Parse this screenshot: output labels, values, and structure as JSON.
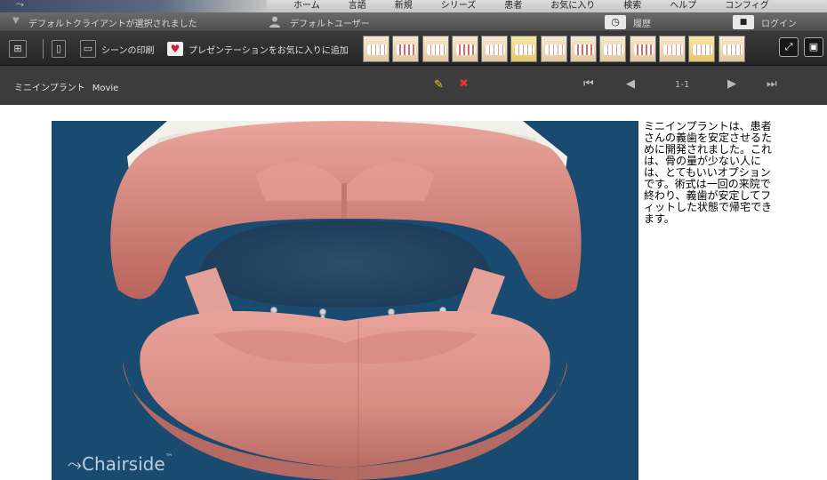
{
  "nav": {
    "items": [
      "ホーム",
      "言語",
      "新規",
      "シリーズ",
      "患者",
      "お気に入り",
      "検索",
      "ヘルプ",
      "コンフィグ"
    ]
  },
  "status": {
    "client": "デフォルトクライアントが選択されました",
    "user": "デフォルトユーザー",
    "history": "履歴",
    "login": "ログイン"
  },
  "toolbar": {
    "print_label": "シーンの印刷",
    "favorite_label": "プレゼンテーションをお気に入りに追加",
    "thumbnail_count": 13
  },
  "titlebar": {
    "title": "ミニインプラント",
    "type": "Movie",
    "page": "1-1"
  },
  "video": {
    "watermark": "Chairside",
    "trademark": "™"
  },
  "description": "ミニインプラントは、患者さんの義歯を安定させるために開発されました。これは、骨の量が少ない人には、とてもいいオプションです。術式は一回の来院で終わり、義歯が安定してフィットした状態で帰宅できます。",
  "colors": {
    "video_bg": "#194a6f",
    "gum": "#d98a83",
    "toolbar": "#2a2a2a",
    "accent_heart": "#d01c3c"
  }
}
